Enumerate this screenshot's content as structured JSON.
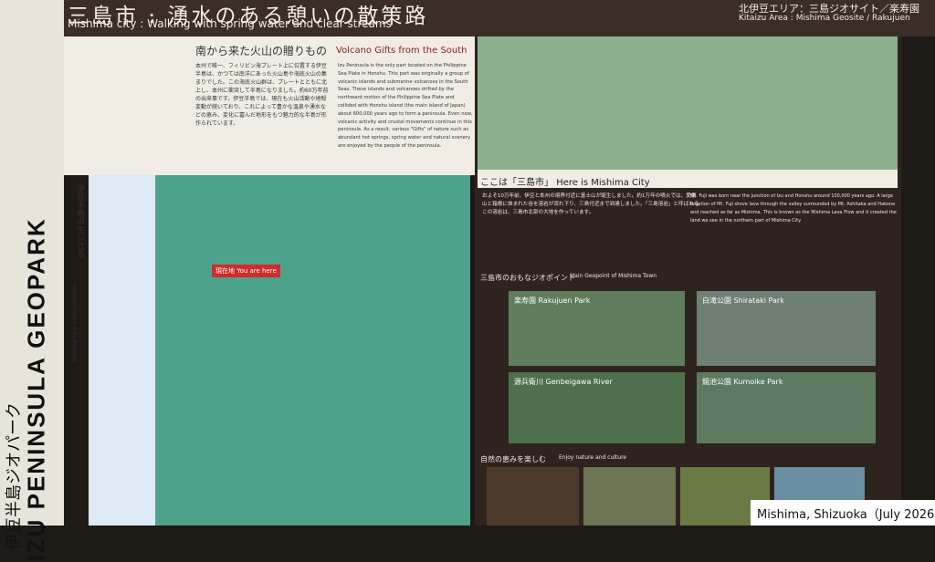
{
  "title": {
    "jp": "三島市 : 湧水のある憩いの散策路",
    "en": "Mishima city : Walking with spring water and clear streams"
  },
  "area": {
    "jp": "北伊豆エリア：三島ジオサイト／楽寿園",
    "en": "Kitaizu Area : Mishima Geosite / Rakujuen"
  },
  "strip": {
    "brand_jp": "伊豆半島ジオパーク",
    "brand_en": "IZU PENINSULA GEOPARK"
  },
  "volcano": {
    "title_jp": "南から来た火山の贈りもの",
    "title_en": "Volcano Gifts from the South",
    "body_jp": "本州で唯一、フィリピン海プレート上に位置する伊豆半島は、かつては南洋にあった火山島や海底火山の集まりでした。この海底火山群は、プレートとともに北上し、本州に衝突して半島になりました。約60万年前の出来事です。伊豆半島では、現在も火山活動や地殻変動が続いており、これによって豊かな温泉や湧水などの恵み、変化に富んだ地形をもつ魅力的な半島が形作られています。",
    "body_en": "Izu Peninsula is the only part located on the Philippine Sea Plate in Honshu. This part was originally a group of volcanic islands and submarine volcanoes in the South Seas. These islands and volcanoes drifted by the northward motion of the Philippine Sea Plate and collided with Honshu island (the main island of Japan) about 600,000 years ago to form a peninsula. Even now, volcanic activity and crustal movements continue in this peninsula. As a result, various \"Gifts\" of nature such as abundant hot springs, spring water and natural scenery are enjoyed by the people of the peninsula."
  },
  "history": {
    "title_jp": "伊豆半島の生い立ち",
    "title_en": "Geological History of Izu Peninsula"
  },
  "map_marker": "現在地 You are here",
  "here": {
    "title": "ここは「三島市」",
    "title_en": "Here is Mishima City",
    "body_jp": "およそ10万年前、伊豆と本州の境界付近に富士山が誕生しました。約1万年の噴火では、愛鷹山と箱根に挟まれた谷を溶岩が流れ下り、三島付近まで到達しました。「三島溶岩」と呼ばれるこの溶岩は、三島市北部の大地を作っています。",
    "body_en": "Mt. Fuji was born near the junction of Izu and Honshu around 100,000 years ago. A large eruption of Mt. Fuji drove lava through the valley surrounded by Mt. Ashitaka and Hakone and reached as far as Mishima. This is known as the Mishima Lava Flow and it created the land we see in the northern part of Mishima City."
  },
  "main_geopoint": {
    "jp": "三島市のおもなジオポイント",
    "en": "Main Geopoint of Mishima Town",
    "items": [
      "楽寿園 Rakujuen Park",
      "白滝公園 Shirataki Park",
      "源兵衛川 Genbeigawa River",
      "鏡池公園 Kumoike Park"
    ]
  },
  "nature": {
    "jp": "自然の恵みを楽しむ",
    "en": "Enjoy nature and culture"
  },
  "caption": "Mishima, Shizuoka（July 2026）"
}
